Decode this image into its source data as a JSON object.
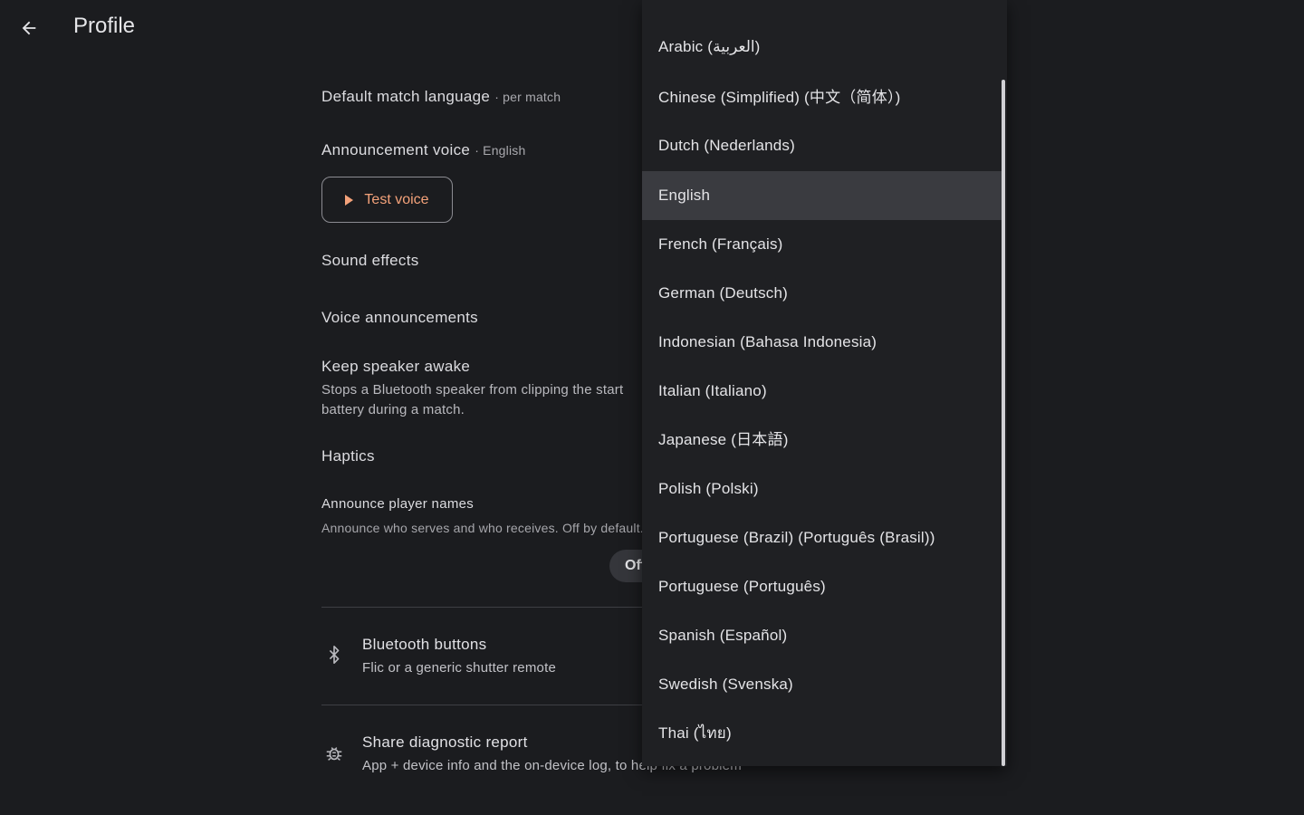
{
  "header": {
    "title": "Profile"
  },
  "settings": {
    "default_match_language": {
      "label": "Default match language",
      "sub": "· per match"
    },
    "announcement_voice": {
      "label": "Announcement voice",
      "sub": "· English"
    },
    "test_voice_label": "Test voice",
    "sound_effects": "Sound effects",
    "voice_announcements": "Voice announcements",
    "keep_speaker_awake": {
      "title": "Keep speaker awake",
      "desc_line1": "Stops a Bluetooth speaker from clipping the start",
      "desc_line2": "battery during a match."
    },
    "haptics": "Haptics",
    "announce_player_names": {
      "title": "Announce player names",
      "desc": "Announce who serves and who receives. Off by default."
    },
    "toggle_value": "Off"
  },
  "list": {
    "bluetooth": {
      "title": "Bluetooth buttons",
      "sub": "Flic or a generic shutter remote"
    },
    "diagnostic": {
      "title": "Share diagnostic report",
      "sub": "App + device info and the on-device log, to help fix a problem"
    }
  },
  "language_menu": {
    "selected": "English",
    "items": [
      "Arabic (العربية)",
      "Chinese (Simplified) (中文（简体）)",
      "Dutch (Nederlands)",
      "English",
      "French (Français)",
      "German (Deutsch)",
      "Indonesian (Bahasa Indonesia)",
      "Italian (Italiano)",
      "Japanese (日本語)",
      "Polish (Polski)",
      "Portuguese (Brazil) (Português (Brasil))",
      "Portuguese (Português)",
      "Spanish (Español)",
      "Swedish (Svenska)",
      "Thai (ไทย)"
    ]
  },
  "icons": {
    "back": "arrow-back-icon",
    "play": "play-icon",
    "bluetooth": "bluetooth-icon",
    "bug": "bug-report-icon"
  },
  "colors": {
    "background": "#1b1c1f",
    "menu_background": "#1f2023",
    "accent": "#f4a27a",
    "selected_item": "#3a3b40"
  }
}
